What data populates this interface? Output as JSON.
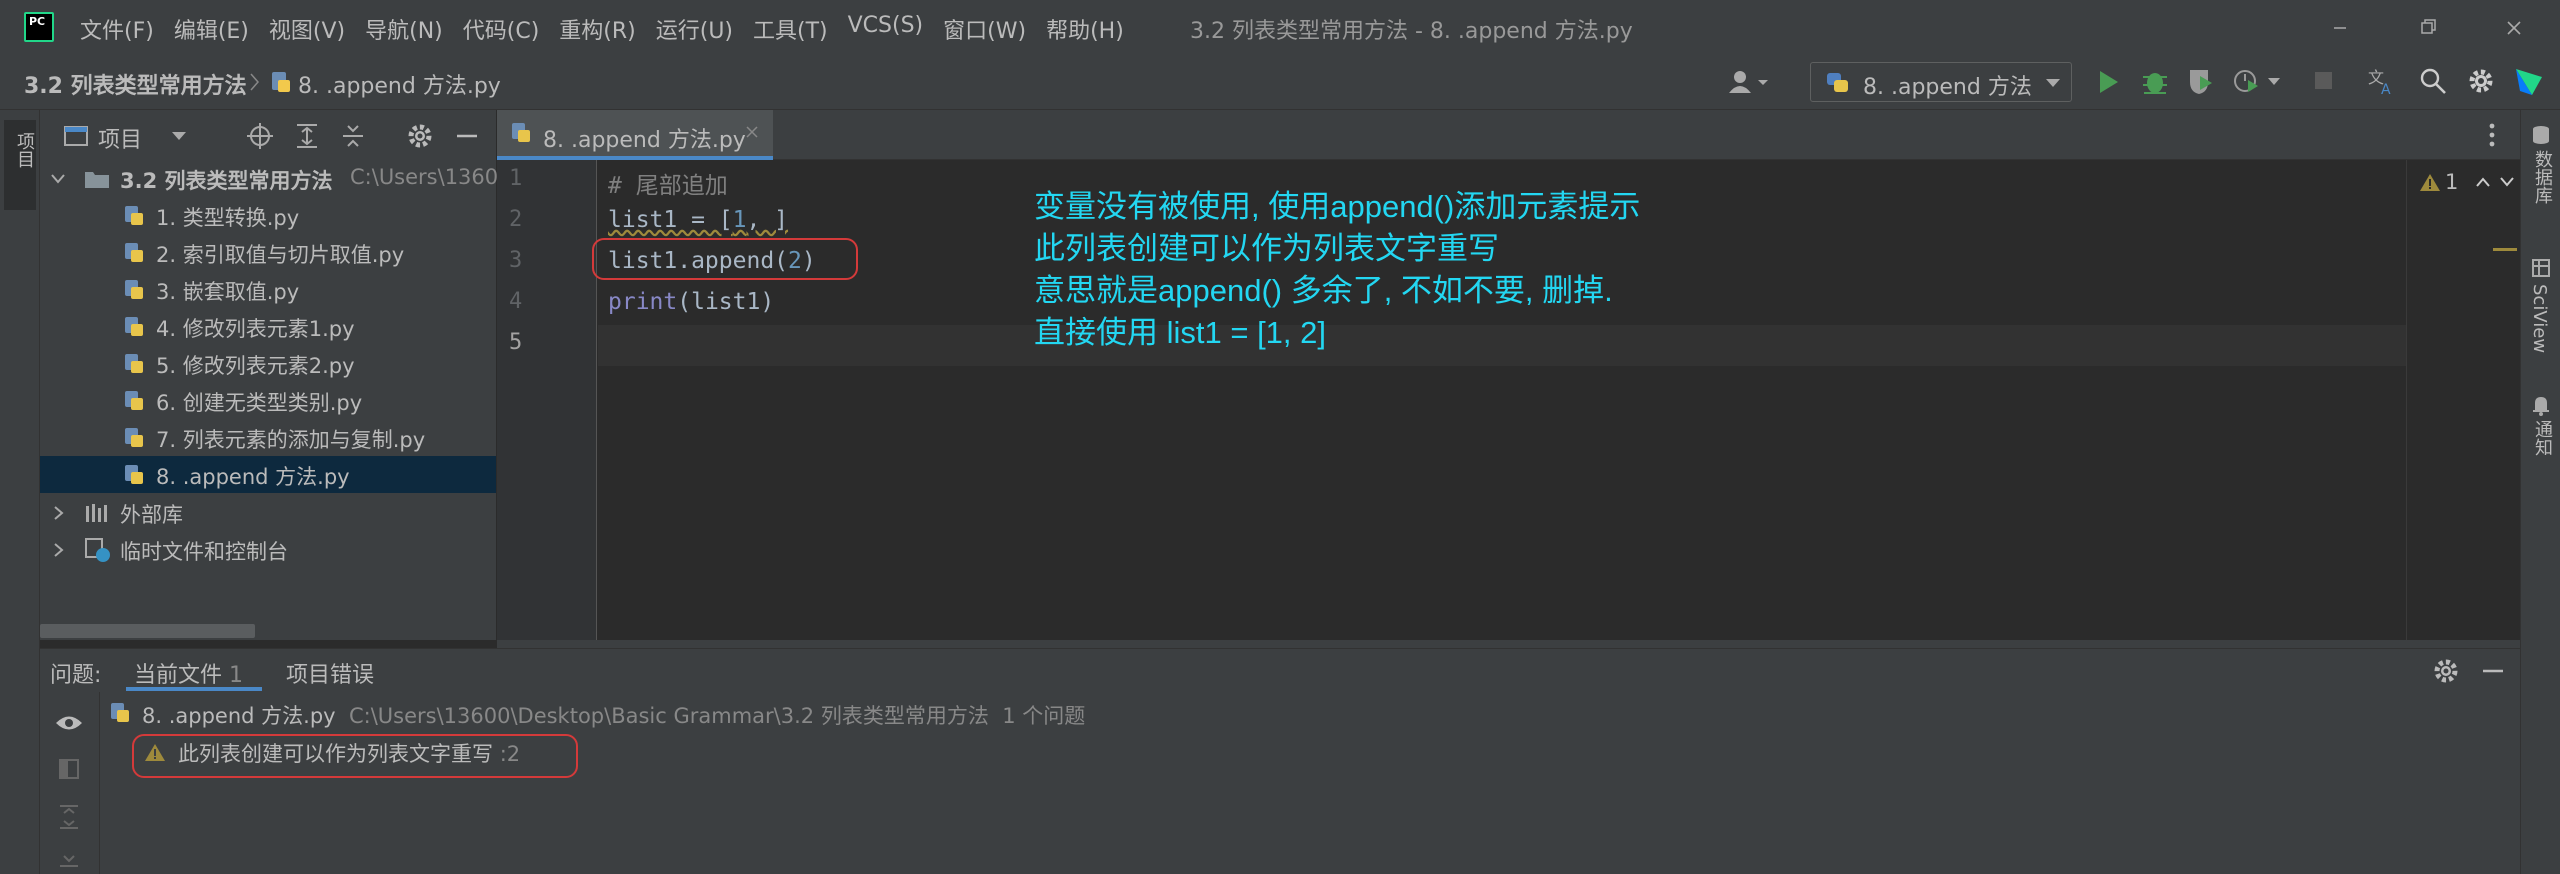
{
  "app": {
    "menu": [
      "文件(F)",
      "编辑(E)",
      "视图(V)",
      "导航(N)",
      "代码(C)",
      "重构(R)",
      "运行(U)",
      "工具(T)",
      "VCS(S)",
      "窗口(W)",
      "帮助(H)"
    ],
    "window_title": "3.2 列表类型常用方法 - 8. .append 方法.py"
  },
  "nav": {
    "crumb_project": "3.2 列表类型常用方法",
    "crumb_file": "8. .append 方法.py",
    "run_config": "8. .append 方法"
  },
  "left_stripe": {
    "project_tab": "项目"
  },
  "right_stripe": {
    "database": "数据库",
    "sciview": "SciView",
    "notifications": "通知"
  },
  "project": {
    "title": "项目",
    "root": {
      "name": "3.2 列表类型常用方法",
      "path": "C:\\Users\\1360"
    },
    "files": [
      "1. 类型转换.py",
      "2. 索引取值与切片取值.py",
      "3. 嵌套取值.py",
      "4. 修改列表元素1.py",
      "5. 修改列表元素2.py",
      "6. 创建无类型类别.py",
      "7. 列表元素的添加与复制.py",
      "8. .append 方法.py"
    ],
    "external_libs": "外部库",
    "scratches": "临时文件和控制台"
  },
  "editor": {
    "tab_label": "8. .append 方法.py",
    "line_numbers": [
      "1",
      "2",
      "3",
      "4",
      "5"
    ],
    "lines": {
      "l1": "# 尾部追加",
      "l2_a": "list1 = [",
      "l2_num": "1",
      "l2_b": ", ]",
      "l3_a": "list1.append(",
      "l3_num": "2",
      "l3_b": ")",
      "l4_kw": "print",
      "l4_b": "(list1)"
    },
    "warning_count": "1"
  },
  "annotation": [
    "变量没有被使用, 使用append()添加元素提示",
    "此列表创建可以作为列表文字重写",
    "意思就是append() 多余了, 不如不要, 删掉.",
    "直接使用 list1 = [1, 2]"
  ],
  "problems": {
    "label": "问题:",
    "tab_current": "当前文件",
    "tab_current_count": "1",
    "tab_project": "项目错误",
    "file_name": "8. .append 方法.py",
    "file_path": "C:\\Users\\13600\\Desktop\\Basic Grammar\\3.2 列表类型常用方法",
    "file_count": "1 个问题",
    "item_text": "此列表创建可以作为列表文字重写",
    "item_loc": ":2"
  },
  "colors": {
    "annotation": "#23d7f2",
    "highlight_box": "#d43a3a",
    "selection": "#0d293e",
    "accent": "#4a88c7"
  }
}
